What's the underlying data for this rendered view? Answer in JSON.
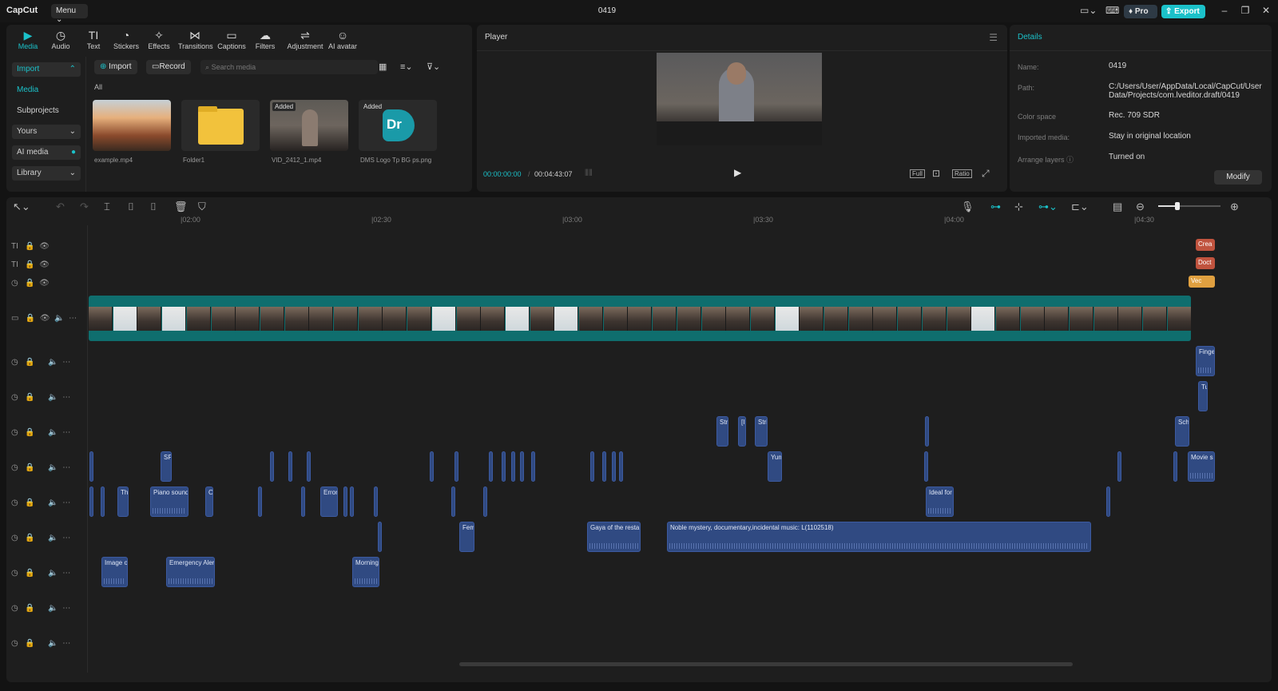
{
  "app": {
    "name": "CapCut",
    "menu_label": "Menu",
    "project_title": "0419",
    "pro_label": "Pro",
    "export_label": "Export"
  },
  "toolbar": {
    "tools": [
      {
        "label": "Media",
        "icon": "media-icon"
      },
      {
        "label": "Audio",
        "icon": "audio-icon"
      },
      {
        "label": "Text",
        "icon": "text-icon"
      },
      {
        "label": "Stickers",
        "icon": "stickers-icon"
      },
      {
        "label": "Effects",
        "icon": "effects-icon"
      },
      {
        "label": "Transitions",
        "icon": "transitions-icon"
      },
      {
        "label": "Captions",
        "icon": "captions-icon"
      },
      {
        "label": "Filters",
        "icon": "filters-icon"
      },
      {
        "label": "Adjustment",
        "icon": "adjustment-icon"
      },
      {
        "label": "AI avatar",
        "icon": "ai-avatar-icon"
      }
    ]
  },
  "media_sidebar": {
    "import": "Import",
    "media": "Media",
    "subprojects": "Subprojects",
    "yours": "Yours",
    "ai_media": "AI media",
    "library": "Library"
  },
  "media_toolbar": {
    "import_btn": "Import",
    "record_btn": "Record",
    "search_placeholder": "Search media",
    "filter_label": "All"
  },
  "media_items": [
    {
      "name": "example.mp4",
      "badge": ""
    },
    {
      "name": "Folder1",
      "badge": ""
    },
    {
      "name": "VID_2412_1.mp4",
      "badge": "Added"
    },
    {
      "name": "DMS Logo Tp BG ps.png",
      "badge": "Added"
    }
  ],
  "player": {
    "title": "Player",
    "current_time": "00:00:00:00",
    "total_time": "00:04:43:07",
    "full_label": "Full",
    "ratio_label": "Ratio"
  },
  "details": {
    "title": "Details",
    "name_key": "Name:",
    "name_val": "0419",
    "path_key": "Path:",
    "path_val": "C:/Users/User/AppData/Local/CapCut/User Data/Projects/com.lveditor.draft/0419",
    "color_key": "Color space",
    "color_val": "Rec. 709 SDR",
    "imported_key": "Imported media:",
    "imported_val": "Stay in original location",
    "arrange_key": "Arrange layers",
    "arrange_val": "Turned on",
    "modify_label": "Modify"
  },
  "timeline": {
    "ruler": [
      "|02:00",
      "|02:30",
      "|03:00",
      "|03:30",
      "|04:00",
      "|04:30"
    ],
    "text_clips": [
      "Crea",
      "Doct",
      "Vec"
    ],
    "audio_clips": [
      "Finge",
      "Tu",
      "Stri",
      "[I",
      "Stri",
      "Sch",
      "SF",
      "Yum",
      "Movie s",
      "Th",
      "Piano sound",
      "O",
      "Error",
      "Ideal for",
      "Fem",
      "Gaya of the resta",
      "Noble mystery, documentary,incidental music: L(1102518)",
      "Image o",
      "Emergency Aler",
      "Morning"
    ]
  },
  "colors": {
    "accent": "#1bc1c9",
    "audio_clip": "#304a82",
    "main_track": "#0f6e6e",
    "text_clip": "#c0533e",
    "sticker_clip": "#e0a040"
  }
}
